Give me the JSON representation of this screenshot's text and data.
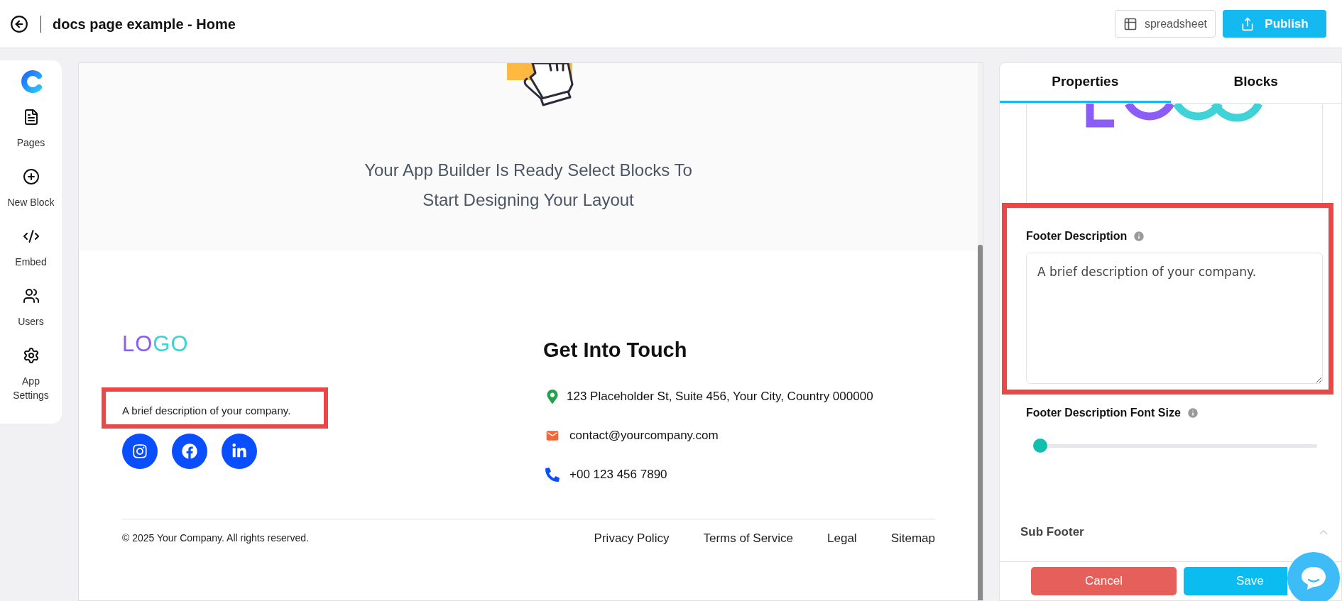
{
  "header": {
    "title": "docs page example - Home",
    "spreadsheet_button": "spreadsheet",
    "publish_button": "Publish"
  },
  "sidebar": {
    "items": [
      {
        "kind": "pages",
        "label": "Pages"
      },
      {
        "kind": "new_block",
        "label": "New Block"
      },
      {
        "kind": "embed",
        "label": "Embed"
      },
      {
        "kind": "users",
        "label": "Users"
      },
      {
        "kind": "settings",
        "label": "App Settings"
      }
    ]
  },
  "canvas": {
    "hero_text": "Your App Builder Is Ready Select Blocks To Start Designing Your Layout",
    "footer": {
      "logo": "LOGO",
      "description": "A brief description of your company.",
      "social": [
        {
          "kind": "instagram"
        },
        {
          "kind": "facebook"
        },
        {
          "kind": "linkedin"
        }
      ],
      "contact_title": "Get Into Touch",
      "contacts": [
        {
          "kind": "address",
          "text": "123 Placeholder St, Suite 456, Your City, Country 000000"
        },
        {
          "kind": "email",
          "text": "contact@yourcompany.com"
        },
        {
          "kind": "phone",
          "text": "+00 123 456 7890"
        }
      ],
      "copyright": "© 2025 Your Company. All rights reserved.",
      "links": [
        "Privacy Policy",
        "Terms of Service",
        "Legal",
        "Sitemap"
      ]
    }
  },
  "panel": {
    "tabs": [
      {
        "label": "Properties",
        "selected": true
      },
      {
        "label": "Blocks",
        "selected": false
      }
    ],
    "fields": [
      {
        "kind": "textarea",
        "label": "Footer Description",
        "value": "A brief description of your company."
      },
      {
        "kind": "slider",
        "label": "Footer Description Font Size",
        "level": 0
      }
    ],
    "section_title": "Sub Footer",
    "cancel_button": "Cancel",
    "save_button": "Save"
  }
}
